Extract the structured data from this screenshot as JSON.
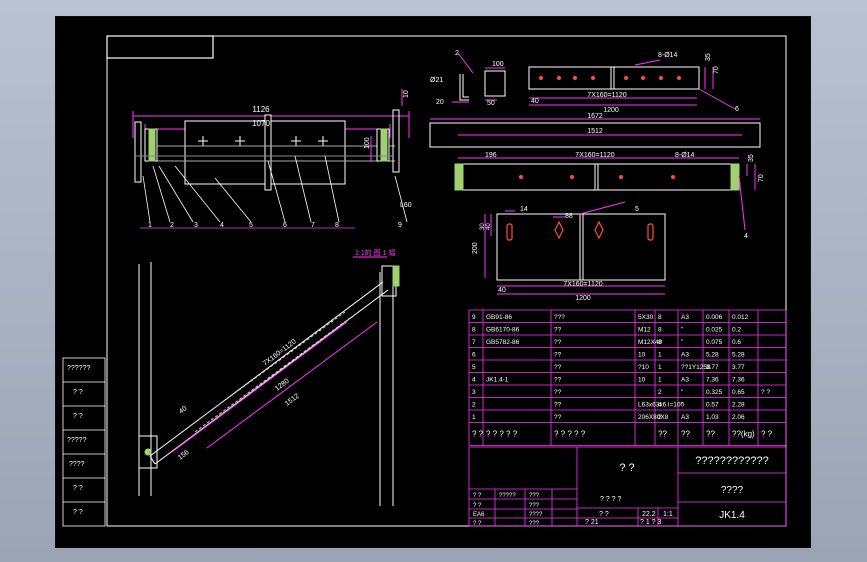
{
  "colors": {
    "background": "#000000",
    "frame": "#ffffff",
    "dimension": "#ff33ff",
    "table_line": "#ff33ff",
    "text": "#ffffff",
    "part_fill": "#a0d070",
    "outer_bg": "#a9b3c2"
  },
  "top_view": {
    "dim_overall": "1126",
    "dim_inner": "1070",
    "dim_side": "10",
    "dim_height": "100",
    "dim_l60": "L60",
    "balloons": [
      "1",
      "2",
      "3",
      "4",
      "5",
      "6",
      "7",
      "8",
      "9"
    ]
  },
  "bracket": {
    "balloon": "2",
    "dim_top": "100",
    "dim_hole": "Ø21",
    "dim_bottom": "20",
    "dim_small": "50"
  },
  "rail_top": {
    "dim_holes": "8-Ø14",
    "dim_side1": "35",
    "dim_side2": "70",
    "dim_start": "40",
    "dim_pitch": "7X160=1120",
    "dim_len": "1200",
    "balloon": "6"
  },
  "rail_mid": {
    "dim_overall": "1672",
    "dim_inner": "1512",
    "dim_start": "196",
    "dim_pitch": "7X160=1120",
    "dim_holes": "8-Ø14",
    "dim_side1": "35",
    "dim_side2": "70",
    "balloon": "4"
  },
  "plate": {
    "dim_w": "14",
    "dim_gap": "88",
    "dim_h1": "30",
    "dim_h2": "40",
    "dim_h3": "200",
    "dim_start": "40",
    "dim_pitch": "7X160=1120",
    "dim_len": "1200",
    "balloon": "5"
  },
  "incline": {
    "title": "1:1的 图 1 幅",
    "dim_pitch": "7X160=1120",
    "dim_len1": "1280",
    "dim_len2": "1512",
    "dim_start": "40",
    "dim_end": "156"
  },
  "revision_block": {
    "rows": [
      "??????",
      "? ?",
      "? ?",
      "?????",
      "????",
      "? ?",
      "? ?"
    ]
  },
  "bom": {
    "rows": [
      {
        "no": "9",
        "code": "GB91-86",
        "name": "???",
        "spec": "5X30",
        "qty": "8",
        "mat": "A3",
        "unit": "0.006",
        "total": "0.012",
        "note": ""
      },
      {
        "no": "8",
        "code": "GB6170-86",
        "name": "??",
        "spec": "M12",
        "qty": "8",
        "mat": "\"",
        "unit": "0.025",
        "total": "0.2",
        "note": ""
      },
      {
        "no": "7",
        "code": "GB5782-86",
        "name": "??",
        "spec": "M12X40",
        "qty": "8",
        "mat": "\"",
        "unit": "0.075",
        "total": "0.6",
        "note": ""
      },
      {
        "no": "6",
        "code": "",
        "name": "??",
        "spec": "10",
        "qty": "1",
        "mat": "A3",
        "unit": "5.28",
        "total": "5.28",
        "note": ""
      },
      {
        "no": "5",
        "code": "",
        "name": "??",
        "spec": "?10",
        "qty": "1",
        "mat": "??1Y1258",
        "unit": "3.77",
        "total": "3.77",
        "note": ""
      },
      {
        "no": "4",
        "code": "JK1.4-1",
        "name": "??",
        "spec": "10",
        "qty": "1",
        "mat": "A3",
        "unit": "7.36",
        "total": "7.36",
        "note": ""
      },
      {
        "no": "3",
        "code": "",
        "name": "??",
        "spec": "",
        "qty": "2",
        "mat": "\"",
        "unit": "0.325",
        "total": "0.65",
        "note": "? ?"
      },
      {
        "no": "2",
        "code": "",
        "name": "??",
        "spec": "L63x63x6   l=100",
        "qty": "4",
        "mat": "\"",
        "unit": "0.57",
        "total": "2.28",
        "note": ""
      },
      {
        "no": "1",
        "code": "",
        "name": "??",
        "spec": "206X80X8",
        "qty": "2",
        "mat": "A3",
        "unit": "1.03",
        "total": "2.06",
        "note": ""
      }
    ],
    "header": {
      "no": "? ?",
      "code": "? ? ? ? ?",
      "name": "? ? ? ? ?",
      "qty": "??",
      "mat": "??",
      "unit": "??",
      "total": "??(kg)",
      "note": "? ?"
    }
  },
  "title_block": {
    "name_center": "? ?",
    "title_right": "????????????",
    "org": "????",
    "drawing_no": "JK1.4",
    "scale_label": "? ?",
    "scale_value": "1:1",
    "weight": "22.2",
    "sheet_total": "? 21",
    "sheet_no": "? 1   ? 3",
    "sign_rows": [
      [
        "? ?",
        "?????",
        "???"
      ],
      [
        "? ?",
        "",
        "???"
      ],
      [
        "EA6",
        "",
        "????"
      ],
      [
        "? ?",
        "",
        "???"
      ],
      [
        "? ?",
        "",
        "???"
      ]
    ],
    "stage": "? ? ? ?"
  }
}
